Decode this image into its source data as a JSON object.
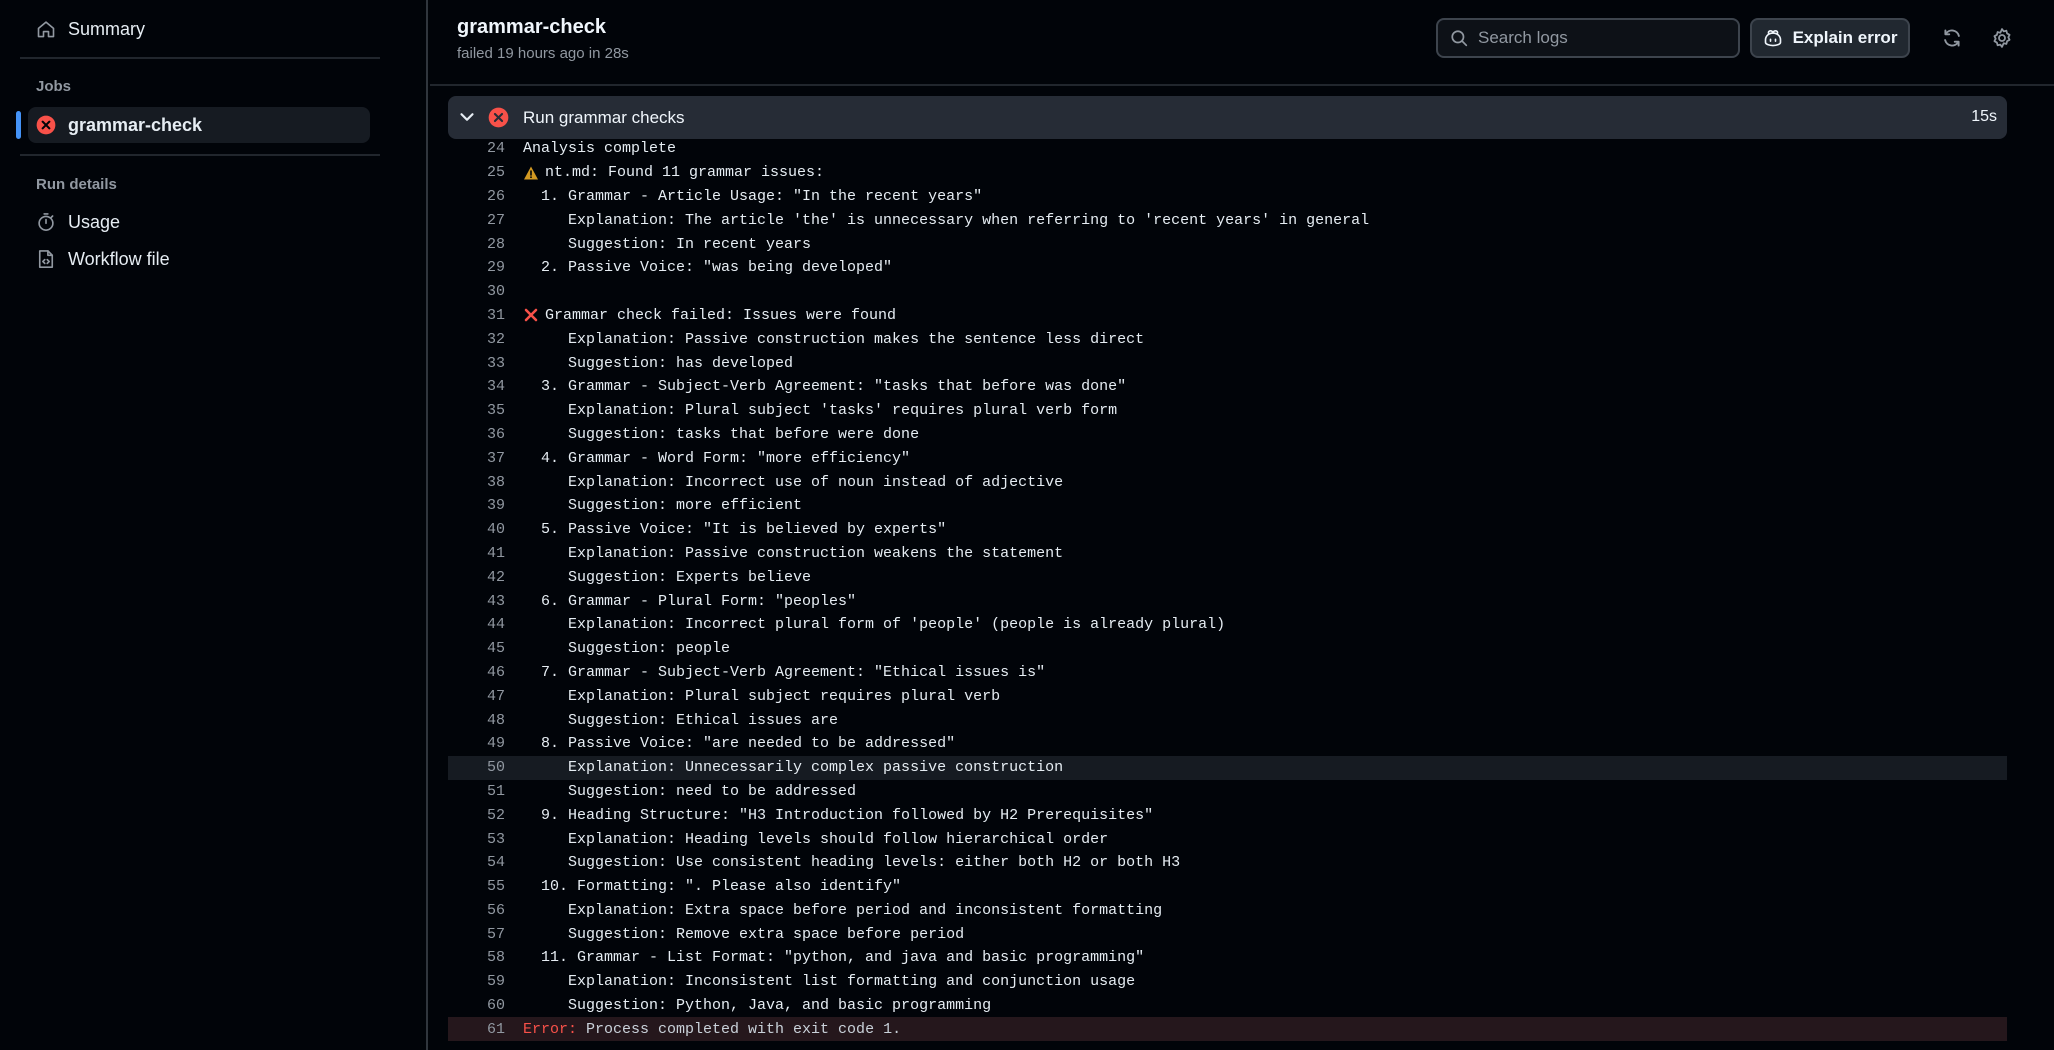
{
  "sidebar": {
    "summary_label": "Summary",
    "jobs_heading": "Jobs",
    "job_label": "grammar-check",
    "run_details_heading": "Run details",
    "usage_label": "Usage",
    "workflow_label": "Workflow file"
  },
  "header": {
    "title": "grammar-check",
    "subtitle": "failed 19 hours ago in 28s",
    "search_placeholder": "Search logs",
    "explain_label": "Explain error"
  },
  "step": {
    "name": "Run grammar checks",
    "duration": "15s"
  },
  "colors": {
    "accent": "#4493f8",
    "error": "#f85149",
    "warning": "#d29922"
  },
  "log_lines": [
    {
      "n": "24",
      "text": "Analysis complete"
    },
    {
      "n": "25",
      "text": "nt.md: Found 11 grammar issues:",
      "mark": "warning-icon"
    },
    {
      "n": "26",
      "text": "  1. Grammar - Article Usage: \"In the recent years\""
    },
    {
      "n": "27",
      "text": "     Explanation: The article 'the' is unnecessary when referring to 'recent years' in general"
    },
    {
      "n": "28",
      "text": "     Suggestion: In recent years"
    },
    {
      "n": "29",
      "text": "  2. Passive Voice: \"was being developed\""
    },
    {
      "n": "30",
      "text": ""
    },
    {
      "n": "31",
      "text": "Grammar check failed: Issues were found",
      "mark": "x-icon"
    },
    {
      "n": "32",
      "text": "     Explanation: Passive construction makes the sentence less direct"
    },
    {
      "n": "33",
      "text": "     Suggestion: has developed"
    },
    {
      "n": "34",
      "text": "  3. Grammar - Subject-Verb Agreement: \"tasks that before was done\""
    },
    {
      "n": "35",
      "text": "     Explanation: Plural subject 'tasks' requires plural verb form"
    },
    {
      "n": "36",
      "text": "     Suggestion: tasks that before were done"
    },
    {
      "n": "37",
      "text": "  4. Grammar - Word Form: \"more efficiency\""
    },
    {
      "n": "38",
      "text": "     Explanation: Incorrect use of noun instead of adjective"
    },
    {
      "n": "39",
      "text": "     Suggestion: more efficient"
    },
    {
      "n": "40",
      "text": "  5. Passive Voice: \"It is believed by experts\""
    },
    {
      "n": "41",
      "text": "     Explanation: Passive construction weakens the statement"
    },
    {
      "n": "42",
      "text": "     Suggestion: Experts believe"
    },
    {
      "n": "43",
      "text": "  6. Grammar - Plural Form: \"peoples\""
    },
    {
      "n": "44",
      "text": "     Explanation: Incorrect plural form of 'people' (people is already plural)"
    },
    {
      "n": "45",
      "text": "     Suggestion: people"
    },
    {
      "n": "46",
      "text": "  7. Grammar - Subject-Verb Agreement: \"Ethical issues is\""
    },
    {
      "n": "47",
      "text": "     Explanation: Plural subject requires plural verb"
    },
    {
      "n": "48",
      "text": "     Suggestion: Ethical issues are"
    },
    {
      "n": "49",
      "text": "  8. Passive Voice: \"are needed to be addressed\""
    },
    {
      "n": "50",
      "text": "     Explanation: Unnecessarily complex passive construction",
      "highlight": true
    },
    {
      "n": "51",
      "text": "     Suggestion: need to be addressed"
    },
    {
      "n": "52",
      "text": "  9. Heading Structure: \"H3 Introduction followed by H2 Prerequisites\""
    },
    {
      "n": "53",
      "text": "     Explanation: Heading levels should follow hierarchical order"
    },
    {
      "n": "54",
      "text": "     Suggestion: Use consistent heading levels: either both H2 or both H3"
    },
    {
      "n": "55",
      "text": "  10. Formatting: \". Please also identify\""
    },
    {
      "n": "56",
      "text": "     Explanation: Extra space before period and inconsistent formatting"
    },
    {
      "n": "57",
      "text": "     Suggestion: Remove extra space before period"
    },
    {
      "n": "58",
      "text": "  11. Grammar - List Format: \"python, and java and basic programming\""
    },
    {
      "n": "59",
      "text": "     Explanation: Inconsistent list formatting and conjunction usage"
    },
    {
      "n": "60",
      "text": "     Suggestion: Python, Java, and basic programming"
    },
    {
      "n": "61",
      "error_label": "Error:",
      "text": " Process completed with exit code 1.",
      "error": true
    }
  ]
}
